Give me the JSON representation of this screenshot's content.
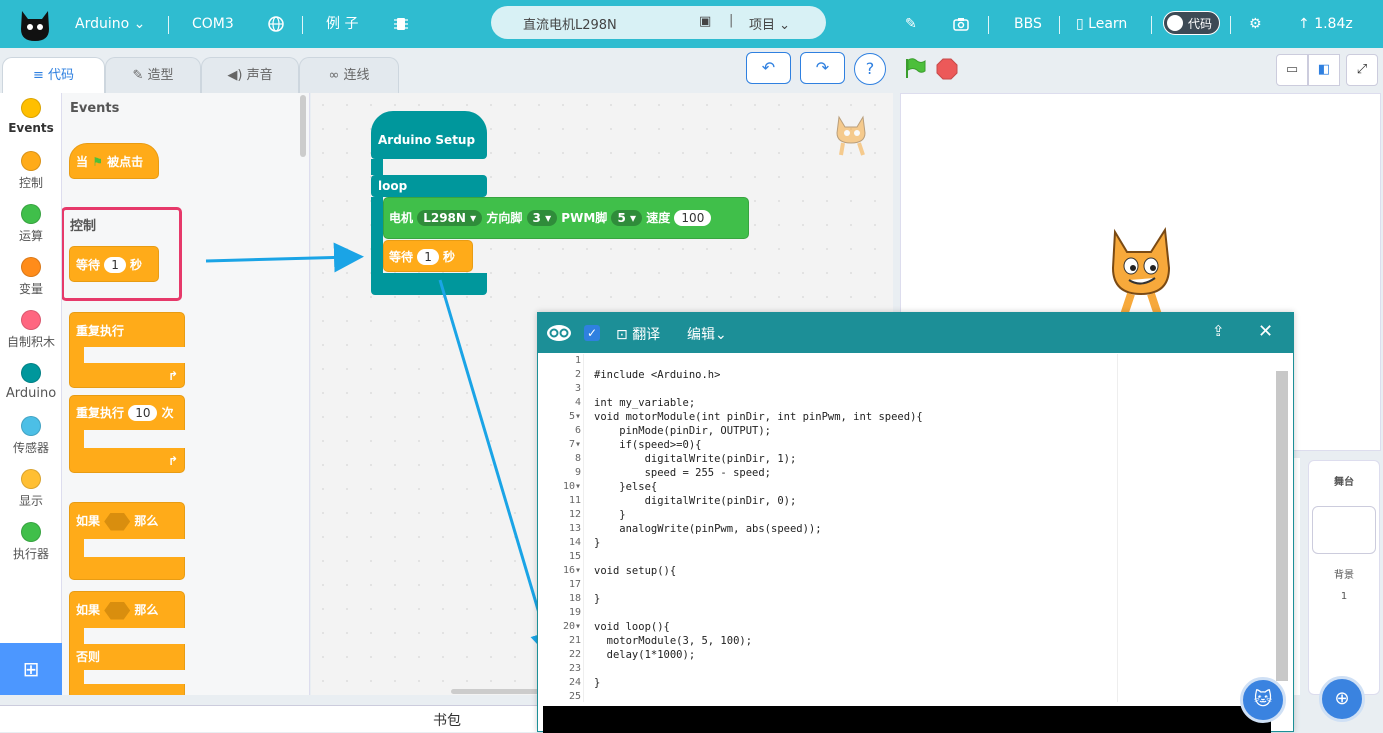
{
  "topbar": {
    "device": "Arduino",
    "port": "COM3",
    "examples": "例 子",
    "project_name": "直流电机L298N",
    "project_menu": "项目",
    "bbs": "BBS",
    "learn": "Learn",
    "code_toggle": "代码",
    "version": "1.84z"
  },
  "tabs": {
    "code": "代码",
    "costume": "造型",
    "sound": "声音",
    "connect": "连线"
  },
  "toolbar": {
    "undo": "↶",
    "redo": "↷",
    "help": "?"
  },
  "categories": [
    {
      "label": "Events",
      "color": "#ffbf00"
    },
    {
      "label": "控制",
      "color": "#ffab19"
    },
    {
      "label": "运算",
      "color": "#40bf4a"
    },
    {
      "label": "变量",
      "color": "#ff8c1a"
    },
    {
      "label": "自制积木",
      "color": "#ff6680"
    },
    {
      "label": "Arduino",
      "color": "#00979c"
    },
    {
      "label": "传感器",
      "color": "#4cbfe6"
    },
    {
      "label": "显示",
      "color": "#ffbf33"
    },
    {
      "label": "执行器",
      "color": "#40bf4a"
    }
  ],
  "palette": {
    "events_title": "Events",
    "when_flag": "当",
    "when_flag_suffix": "被点击",
    "control_title": "控制",
    "wait_label": "等待",
    "wait_value": "1",
    "wait_unit": "秒",
    "forever_label": "重复执行",
    "repeat_label": "重复执行",
    "repeat_value": "10",
    "repeat_unit": "次",
    "if_label": "如果",
    "then_label": "那么",
    "if2_label": "如果",
    "then2_label": "那么",
    "else_label": "否则"
  },
  "workspace": {
    "setup_label": "Arduino Setup",
    "loop_label": "loop",
    "motor_label": "电机",
    "motor_driver": "L298N",
    "dir_pin_label": "方向脚",
    "dir_pin": "3",
    "pwm_pin_label": "PWM脚",
    "pwm_pin": "5",
    "speed_label": "速度",
    "speed_value": "100",
    "wait_label": "等待",
    "wait_value": "1",
    "wait_unit": "秒"
  },
  "codewin": {
    "translate": "翻译",
    "edit": "编辑"
  },
  "code": {
    "lines": [
      "",
      "#include <Arduino.h>",
      "",
      "int my_variable;",
      "void motorModule(int pinDir, int pinPwm, int speed){",
      "    pinMode(pinDir, OUTPUT);",
      "    if(speed>=0){",
      "        digitalWrite(pinDir, 1);",
      "        speed = 255 - speed;",
      "    }else{",
      "        digitalWrite(pinDir, 0);",
      "    }",
      "    analogWrite(pinPwm, abs(speed));",
      "}",
      "",
      "void setup(){",
      "",
      "}",
      "",
      "void loop(){",
      "  motorModule(3, 5, 100);",
      "  delay(1*1000);",
      "",
      "}",
      ""
    ],
    "numbers": [
      "1",
      "2",
      "3",
      "4",
      "5",
      "6",
      "7",
      "8",
      "9",
      "10",
      "11",
      "12",
      "13",
      "14",
      "15",
      "16",
      "17",
      "18",
      "19",
      "20",
      "21",
      "22",
      "23",
      "24",
      "25"
    ]
  },
  "stage_panel": {
    "stage_label": "舞台",
    "backdrop_label": "背景",
    "backdrop_count": "1"
  },
  "bottom": {
    "backpack": "书包"
  }
}
